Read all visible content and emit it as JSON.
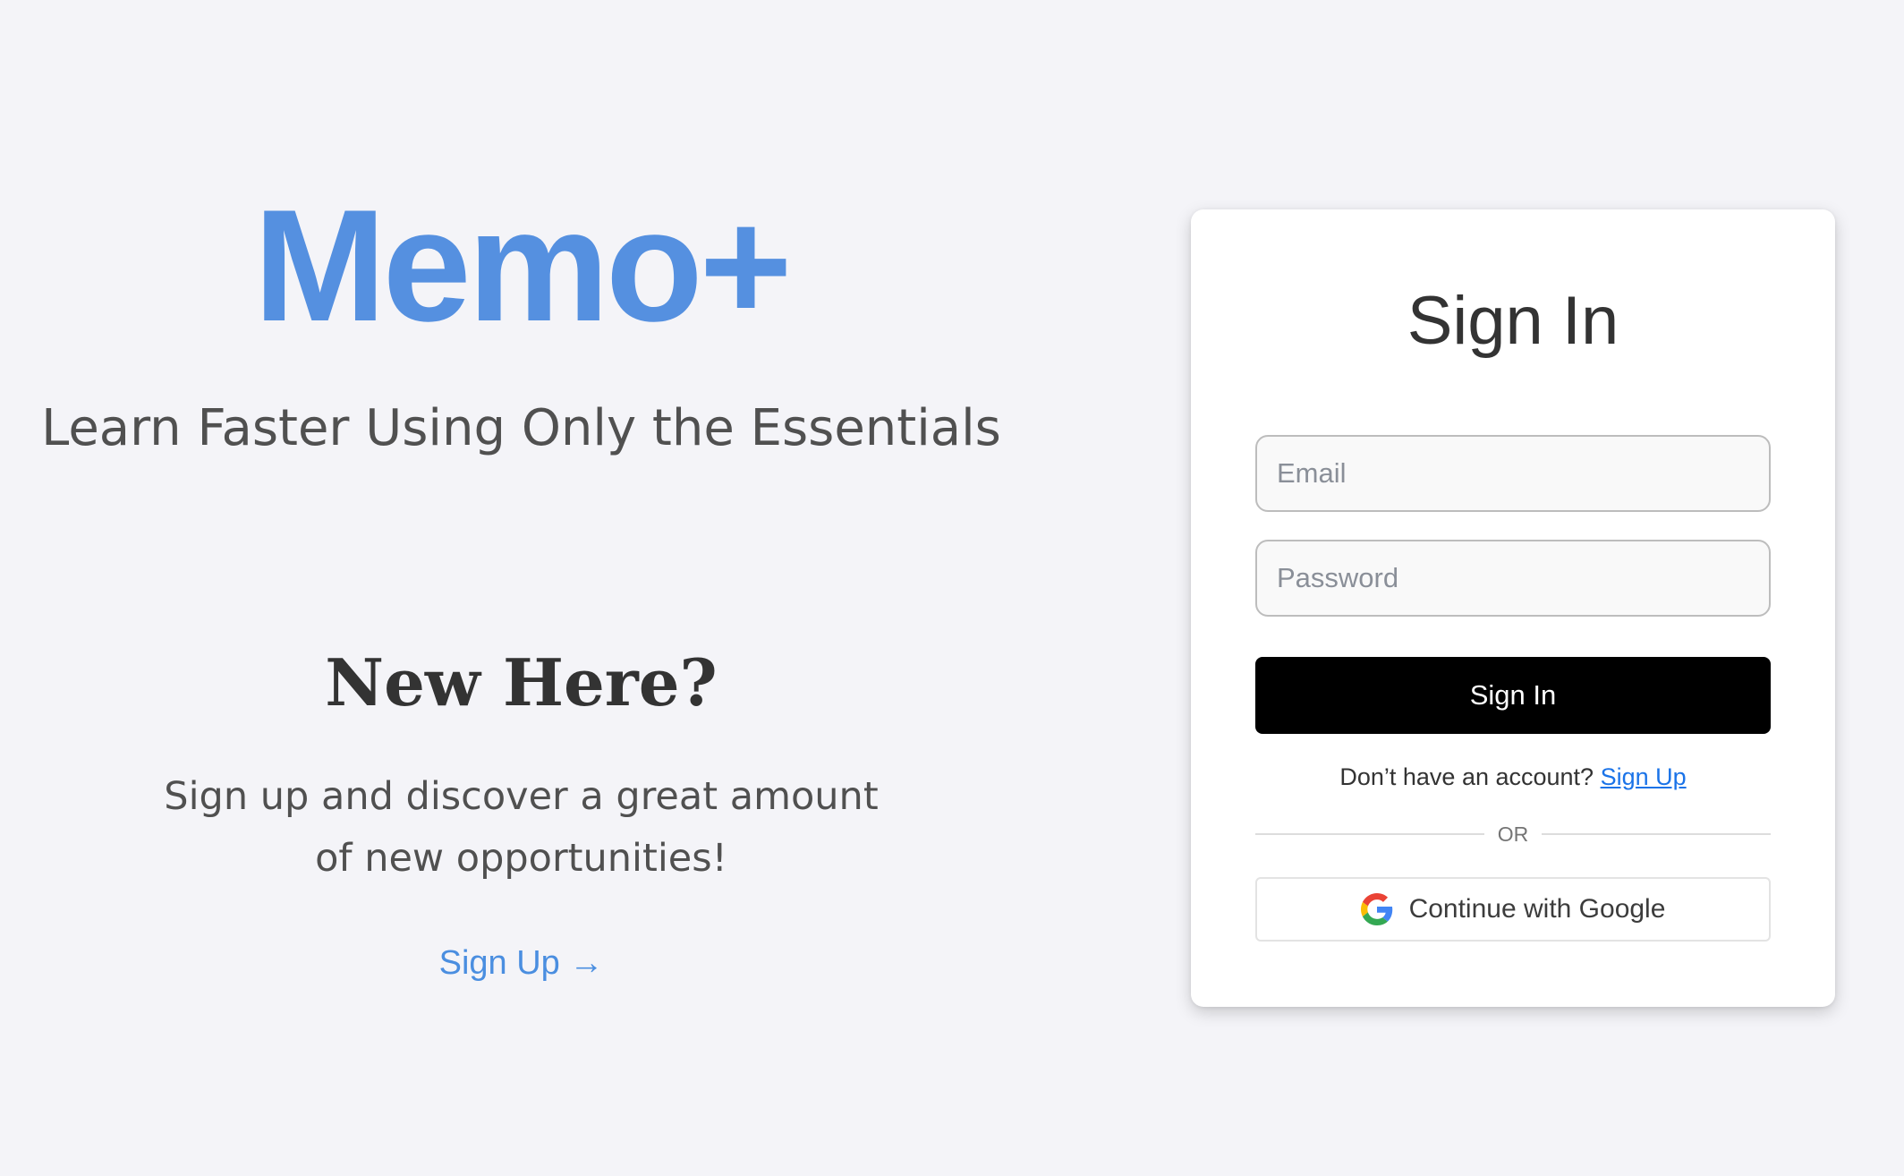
{
  "brand": {
    "name": "Memo+",
    "tagline": "Learn Faster Using Only the Essentials"
  },
  "promo": {
    "heading": "New Here?",
    "text": "Sign up and discover a great amount of new opportunities!",
    "signup_link": "Sign Up →"
  },
  "signin": {
    "title": "Sign In",
    "email_placeholder": "Email",
    "password_placeholder": "Password",
    "submit_label": "Sign In",
    "no_account_text": "Don’t have an account?",
    "signup_link": "Sign Up",
    "divider_text": "OR",
    "google_label": "Continue with Google",
    "google_icon": "google-g-icon"
  },
  "colors": {
    "background": "#f4f4f8",
    "brand_blue": "#5590e0",
    "link_blue": "#4a8ee0",
    "primary_button": "#000000",
    "card": "#ffffff"
  }
}
